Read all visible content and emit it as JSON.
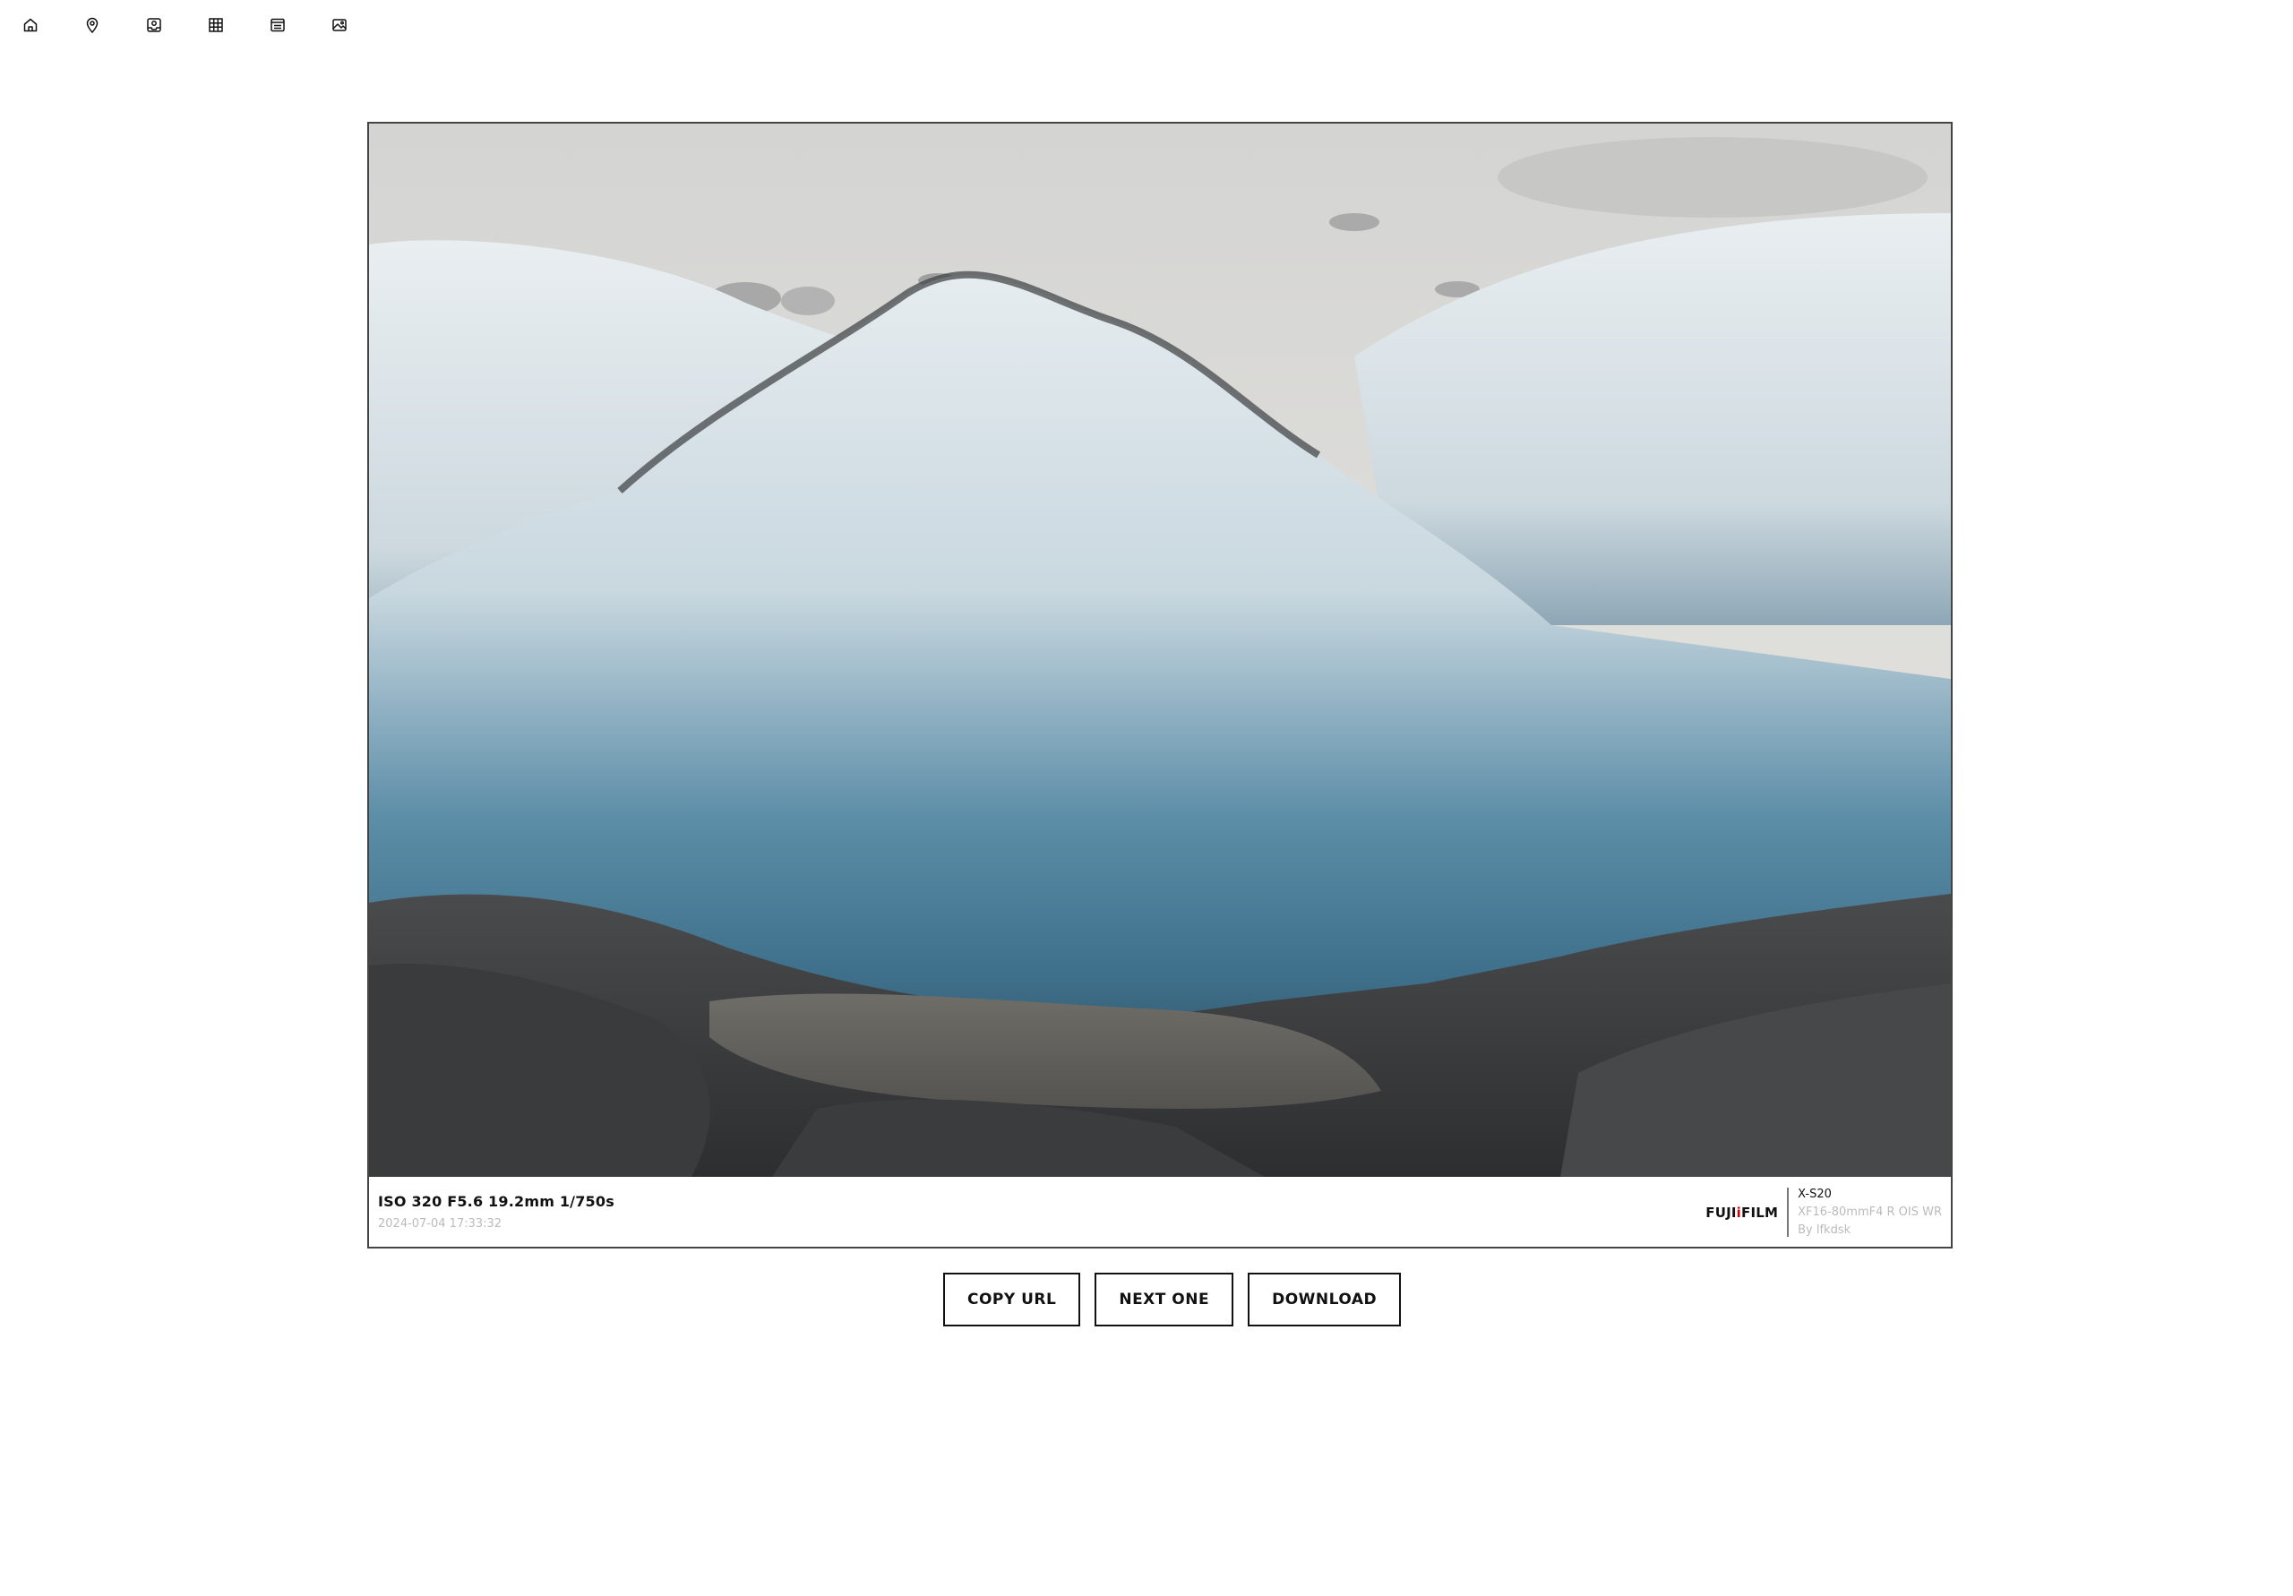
{
  "nav": {
    "items": [
      {
        "icon": "home-icon"
      },
      {
        "icon": "map-pin-icon"
      },
      {
        "icon": "camera-roll-icon"
      },
      {
        "icon": "grid-icon"
      },
      {
        "icon": "list-icon"
      },
      {
        "icon": "image-icon"
      }
    ]
  },
  "photo": {
    "exif": "ISO 320 F5.6 19.2mm 1/750s",
    "datetime": "2024-07-04 17:33:32",
    "brand_prefix": "FUJI",
    "brand_dot": "i",
    "brand_suffix": "FILM",
    "model": "X-S20",
    "lens": "XF16-80mmF4 R OIS WR",
    "author": "By lfkdsk"
  },
  "actions": {
    "copy_url": "COPY URL",
    "next_one": "NEXT ONE",
    "download": "DOWNLOAD"
  },
  "colors": {
    "border": "#444444",
    "button_border": "#111111",
    "muted_text": "#bbbbbb"
  }
}
